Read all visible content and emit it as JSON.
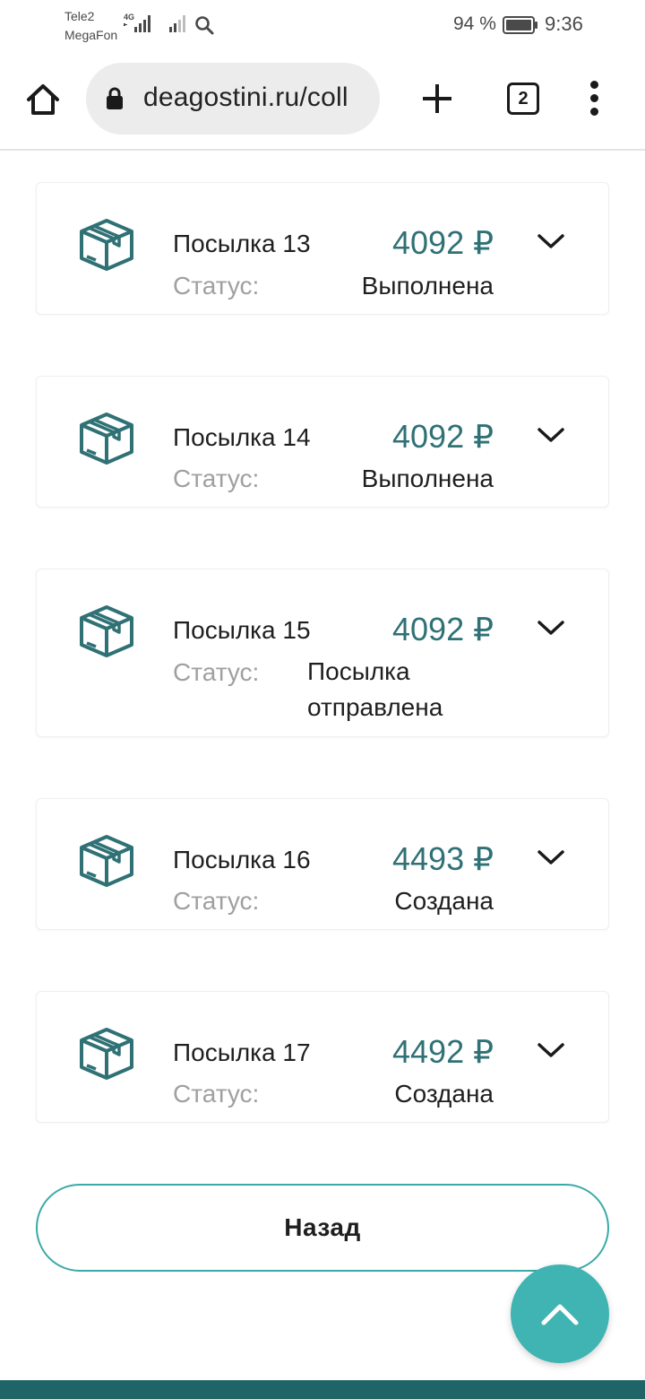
{
  "status_bar": {
    "carrier_1": "Tele2",
    "carrier_2": "MegaFon",
    "network_type": "4G",
    "battery_percent": "94 %",
    "time": "9:36"
  },
  "browser": {
    "url": "deagostini.ru/coll",
    "tab_count": "2"
  },
  "orders": [
    {
      "name": "Посылка 13",
      "price": "4092 ₽",
      "status_label": "Статус:",
      "status": "Выполнена"
    },
    {
      "name": "Посылка 14",
      "price": "4092 ₽",
      "status_label": "Статус:",
      "status": "Выполнена"
    },
    {
      "name": "Посылка 15",
      "price": "4092 ₽",
      "status_label": "Статус:",
      "status": "Посылка отправлена"
    },
    {
      "name": "Посылка 16",
      "price": "4493 ₽",
      "status_label": "Статус:",
      "status": "Создана"
    },
    {
      "name": "Посылка 17",
      "price": "4492 ₽",
      "status_label": "Статус:",
      "status": "Создана"
    }
  ],
  "back_button": {
    "label": "Назад"
  },
  "icons": {
    "box": "package-icon",
    "chevron": "chevron-down-icon",
    "fab": "chevron-up-icon"
  },
  "colors": {
    "accent": "#2f7175",
    "button_border": "#3aa9a8",
    "fab": "#3fb4b2",
    "footer": "#1f6466"
  }
}
